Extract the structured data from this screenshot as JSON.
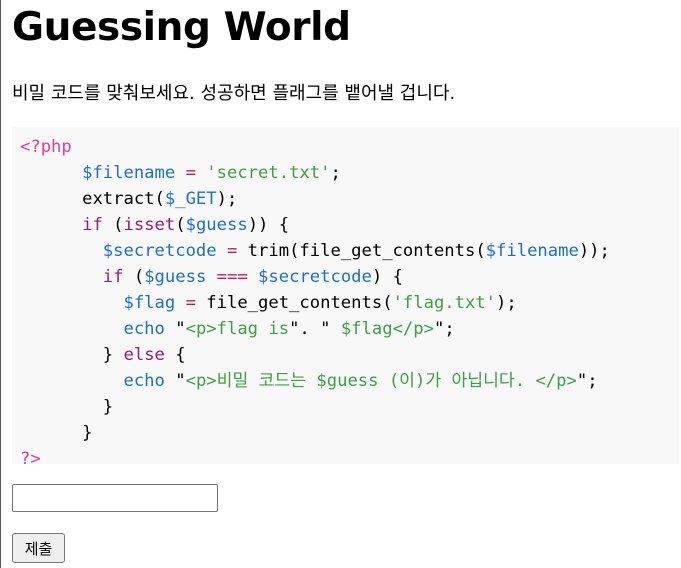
{
  "page": {
    "title": "Guessing World",
    "description": "비밀 코드를 맞춰보세요. 성공하면 플래그를 뱉어낼 겁니다."
  },
  "code": {
    "lines": [
      [
        {
          "t": "<?php",
          "c": "tag"
        }
      ],
      [
        {
          "t": "      ",
          "c": "plain"
        },
        {
          "t": "$filename",
          "c": "var"
        },
        {
          "t": " = ",
          "c": "op"
        },
        {
          "t": "'secret.txt'",
          "c": "str"
        },
        {
          "t": ";",
          "c": "plain"
        }
      ],
      [
        {
          "t": "      ",
          "c": "plain"
        },
        {
          "t": "extract(",
          "c": "fn"
        },
        {
          "t": "$_GET",
          "c": "var"
        },
        {
          "t": ");",
          "c": "plain"
        }
      ],
      [
        {
          "t": "      ",
          "c": "plain"
        },
        {
          "t": "if",
          "c": "kw"
        },
        {
          "t": " (",
          "c": "plain"
        },
        {
          "t": "isset",
          "c": "kw"
        },
        {
          "t": "(",
          "c": "plain"
        },
        {
          "t": "$guess",
          "c": "var"
        },
        {
          "t": ")) {",
          "c": "plain"
        }
      ],
      [
        {
          "t": "        ",
          "c": "plain"
        },
        {
          "t": "$secretcode",
          "c": "var"
        },
        {
          "t": " = ",
          "c": "op"
        },
        {
          "t": "trim(file_get_contents(",
          "c": "fn"
        },
        {
          "t": "$filename",
          "c": "var"
        },
        {
          "t": "));",
          "c": "plain"
        }
      ],
      [
        {
          "t": "        ",
          "c": "plain"
        },
        {
          "t": "if",
          "c": "kw"
        },
        {
          "t": " (",
          "c": "plain"
        },
        {
          "t": "$guess",
          "c": "var"
        },
        {
          "t": " === ",
          "c": "op"
        },
        {
          "t": "$secretcode",
          "c": "var"
        },
        {
          "t": ") {",
          "c": "plain"
        }
      ],
      [
        {
          "t": "          ",
          "c": "plain"
        },
        {
          "t": "$flag",
          "c": "var"
        },
        {
          "t": " = ",
          "c": "op"
        },
        {
          "t": "file_get_contents(",
          "c": "fn"
        },
        {
          "t": "'flag.txt'",
          "c": "str"
        },
        {
          "t": ");",
          "c": "plain"
        }
      ],
      [
        {
          "t": "          ",
          "c": "plain"
        },
        {
          "t": "echo",
          "c": "var"
        },
        {
          "t": " \"",
          "c": "plain"
        },
        {
          "t": "<p>flag is",
          "c": "str"
        },
        {
          "t": "\". \"",
          "c": "plain"
        },
        {
          "t": " $flag</p>",
          "c": "str"
        },
        {
          "t": "\";",
          "c": "plain"
        }
      ],
      [
        {
          "t": "        ",
          "c": "plain"
        },
        {
          "t": "} ",
          "c": "plain"
        },
        {
          "t": "else",
          "c": "kw"
        },
        {
          "t": " {",
          "c": "plain"
        }
      ],
      [
        {
          "t": "          ",
          "c": "plain"
        },
        {
          "t": "echo",
          "c": "var"
        },
        {
          "t": " \"",
          "c": "plain"
        },
        {
          "t": "<p>비밀 코드는 $guess (이)가 아닙니다. </p>",
          "c": "str"
        },
        {
          "t": "\";",
          "c": "plain"
        }
      ],
      [
        {
          "t": "        ",
          "c": "plain"
        },
        {
          "t": "}",
          "c": "plain"
        }
      ],
      [
        {
          "t": "      ",
          "c": "plain"
        },
        {
          "t": "}",
          "c": "plain"
        }
      ],
      [
        {
          "t": "?>",
          "c": "tag"
        }
      ]
    ]
  },
  "form": {
    "input_value": "",
    "input_placeholder": "",
    "submit_label": "제출"
  }
}
